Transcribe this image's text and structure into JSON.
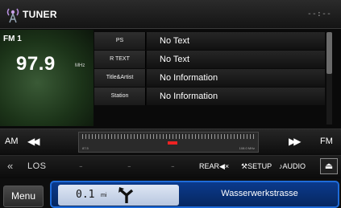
{
  "header": {
    "title": "TUNER",
    "clock": "--:--"
  },
  "tuner": {
    "band": "FM 1",
    "frequency": "97.9",
    "unit": "MHz"
  },
  "info_rows": [
    {
      "label": "PS",
      "value": "No Text"
    },
    {
      "label": "R TEXT",
      "value": "No Text"
    },
    {
      "label": "Title&Artist",
      "value": "No Information"
    },
    {
      "label": "Station",
      "value": "No Information"
    }
  ],
  "seek": {
    "am_label": "AM",
    "fm_label": "FM",
    "scale_min": "87.5",
    "scale_max": "108.0 MHz"
  },
  "functions": {
    "los_label": "LOS",
    "rear_label": "REAR",
    "setup_label": "SETUP",
    "audio_label": "AUDIO"
  },
  "nav": {
    "menu_label": "Menu",
    "distance": "0.1",
    "distance_unit": "mi",
    "street": "Wasserwerkstrasse"
  }
}
